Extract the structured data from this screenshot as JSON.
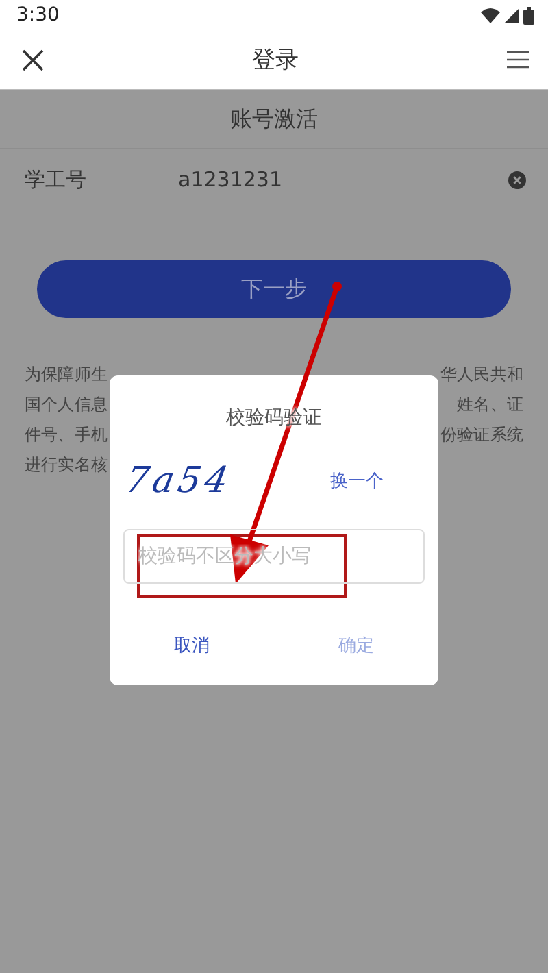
{
  "status_bar": {
    "time": "3:30"
  },
  "header": {
    "title": "登录"
  },
  "page": {
    "subtitle": "账号激活",
    "field": {
      "label": "学工号",
      "value": "a1231231"
    },
    "next_button": "下一步",
    "notice_lines": [
      {
        "left": "为保障师生",
        "right": "华人民共和"
      },
      {
        "left": "国个人信息",
        "right": "姓名、证"
      },
      {
        "left": "件号、手机",
        "right": "份验证系统"
      },
      {
        "left": "进行实名核"
      }
    ]
  },
  "dialog": {
    "title": "校验码验证",
    "captcha": "7a54",
    "refresh": "换一个",
    "input": {
      "placeholder": "校验码不区分大小写"
    },
    "buttons": [
      "取消",
      "确定"
    ]
  }
}
